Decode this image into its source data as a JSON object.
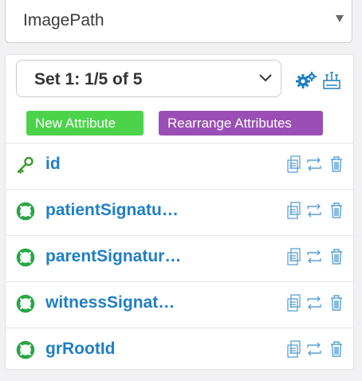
{
  "top_select": {
    "value": "ImagePath"
  },
  "set_select": {
    "value": "Set 1: 1/5 of 5"
  },
  "buttons": {
    "new_attribute": "New Attribute",
    "rearrange_attributes": "Rearrange Attributes"
  },
  "attributes": [
    {
      "name": "id",
      "icon": "key-icon"
    },
    {
      "name": "patientSignatu…",
      "icon": "lifebuoy-icon"
    },
    {
      "name": "parentSignatur…",
      "icon": "lifebuoy-icon"
    },
    {
      "name": "witnessSignat…",
      "icon": "lifebuoy-icon"
    },
    {
      "name": "grRootId",
      "icon": "lifebuoy-icon"
    }
  ],
  "colors": {
    "accent": "#1f7fc3",
    "key": "#3a9a2a",
    "lifebuoy": "#27a645",
    "new_attribute_bg": "#4cd34a",
    "rearrange_bg": "#9b4fb6"
  }
}
